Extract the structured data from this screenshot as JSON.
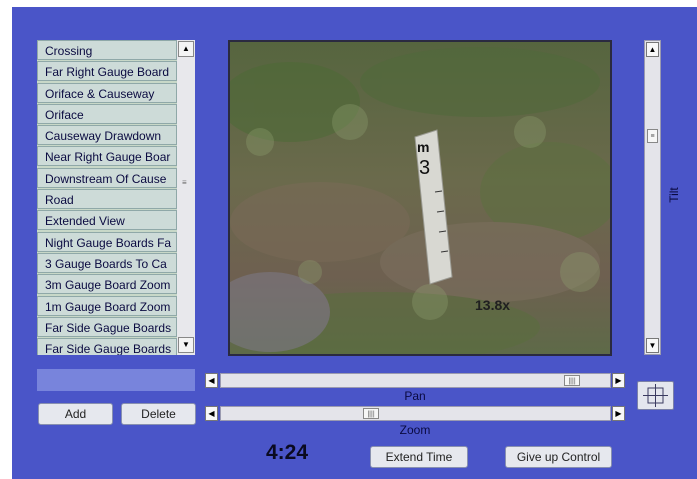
{
  "presets": {
    "items": [
      "Crossing",
      "Far Right Gauge Board",
      "Oriface & Causeway",
      "Oriface",
      "Causeway Drawdown",
      "Near Right Gauge Boar",
      "Downstream Of Cause",
      "Road",
      "Extended View",
      "Night Gauge Boards Fa",
      "3 Gauge Boards To Ca",
      "3m Gauge Board Zoom",
      "1m Gauge Board Zoom",
      "Far Side Gague Boards",
      "Far Side Gauge Boards"
    ],
    "name_value": "",
    "add_label": "Add",
    "delete_label": "Delete"
  },
  "video": {
    "gauge_unit": "m",
    "gauge_number": "3",
    "zoom_overlay": "13.8x"
  },
  "controls": {
    "pan_label": "Pan",
    "zoom_label": "Zoom",
    "tilt_label": "Tilt",
    "pan_level": 0.92,
    "zoom_level": 0.38,
    "tilt_level": 0.27
  },
  "session": {
    "time_remaining": "4:24",
    "extend_label": "Extend Time",
    "give_up_label": "Give up Control"
  },
  "icons": {
    "scroll_up": "arrow-up-icon",
    "scroll_down": "arrow-down-icon",
    "scroll_left": "arrow-left-icon",
    "scroll_right": "arrow-right-icon",
    "center": "crosshair-icon"
  },
  "colors": {
    "panel": "#4a55c8",
    "list_item": "#cddbd8",
    "input": "#7884dc"
  }
}
